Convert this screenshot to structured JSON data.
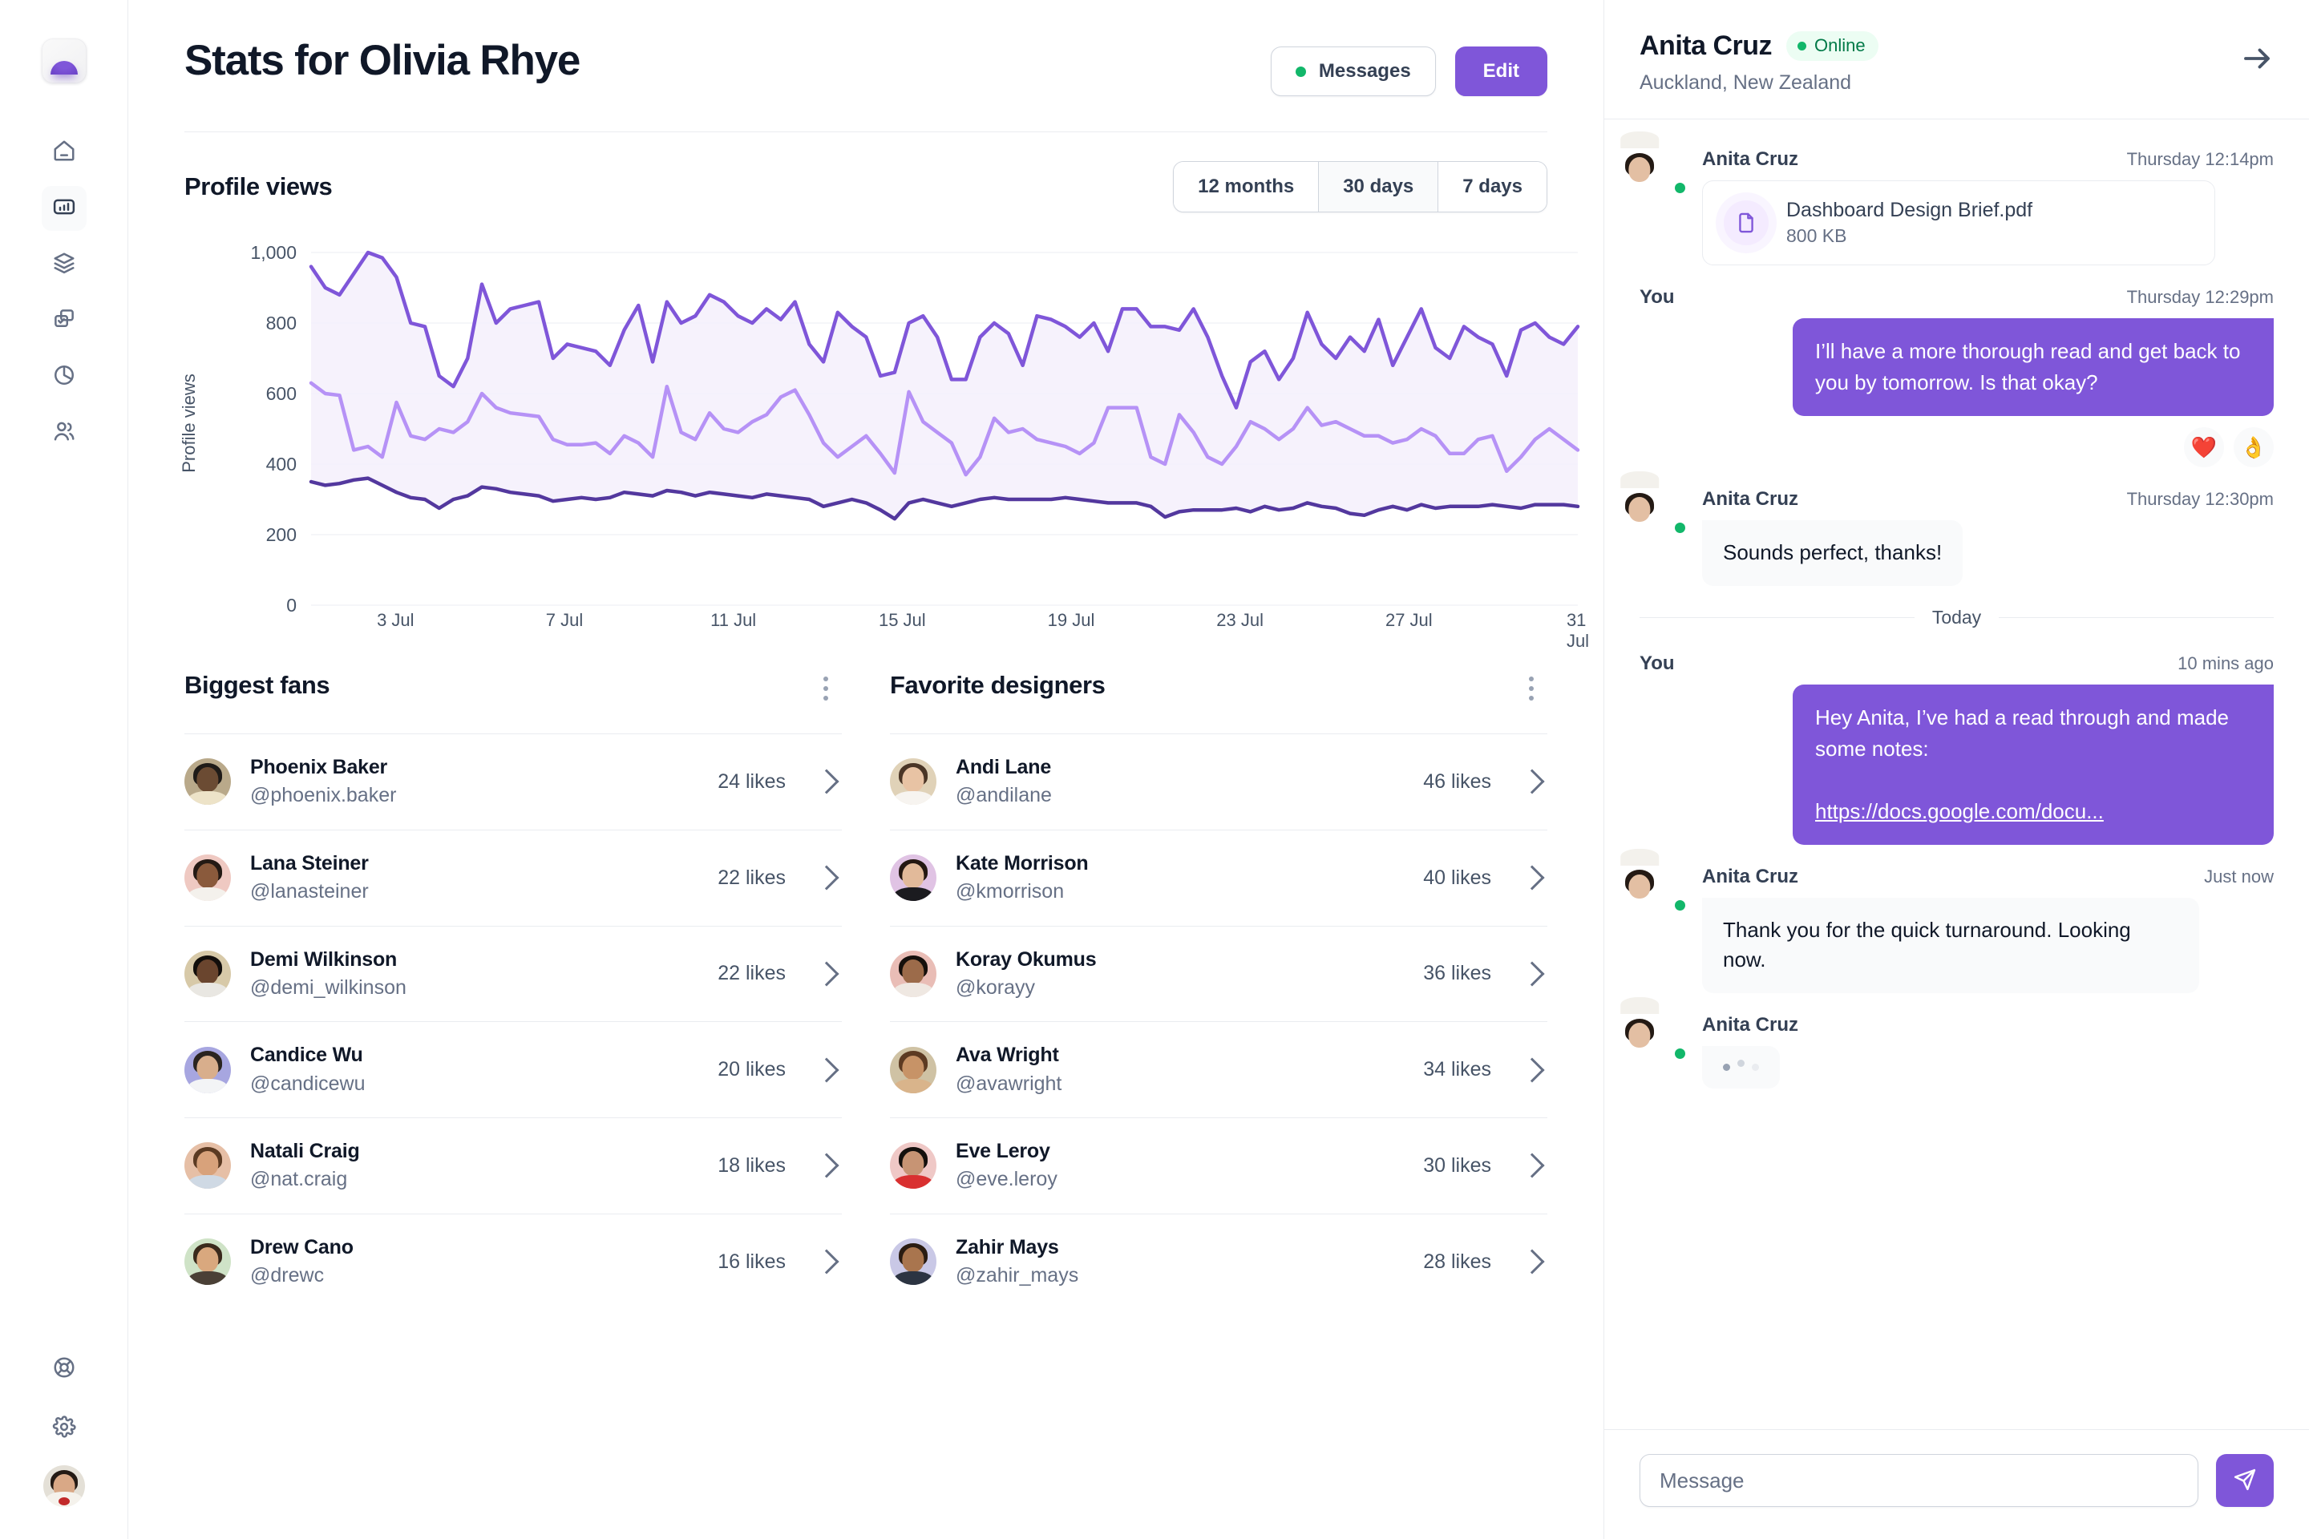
{
  "sidebar": {
    "logo_name": "app-logo",
    "items": [
      {
        "name": "home",
        "icon": "home-icon",
        "active": false
      },
      {
        "name": "stats",
        "icon": "bar-chart-icon",
        "active": true
      },
      {
        "name": "layers",
        "icon": "layers-icon",
        "active": false
      },
      {
        "name": "projects",
        "icon": "checkbox-window-icon",
        "active": false
      },
      {
        "name": "reports",
        "icon": "pie-chart-icon",
        "active": false
      },
      {
        "name": "users",
        "icon": "users-icon",
        "active": false
      }
    ],
    "bottom_items": [
      {
        "name": "support",
        "icon": "lifebuoy-icon"
      },
      {
        "name": "settings",
        "icon": "gear-icon"
      }
    ],
    "profile_avatar": "user-avatar"
  },
  "header": {
    "title": "Stats for Olivia Rhye",
    "messages_label": "Messages",
    "edit_label": "Edit"
  },
  "chart_card": {
    "title": "Profile views",
    "ranges": [
      {
        "label": "12 months",
        "active": false
      },
      {
        "label": "30 days",
        "active": true
      },
      {
        "label": "7 days",
        "active": false
      }
    ]
  },
  "chart_data": {
    "type": "line",
    "title": "Profile views",
    "xlabel": "",
    "ylabel": "Profile views",
    "ylim": [
      0,
      1000
    ],
    "yticks": [
      "0",
      "200",
      "400",
      "600",
      "800",
      "1,000"
    ],
    "xticks": [
      "3 Jul",
      "7 Jul",
      "11 Jul",
      "15 Jul",
      "19 Jul",
      "23 Jul",
      "27 Jul",
      "31 Jul"
    ],
    "grid": true,
    "legend": "none",
    "area_fill": true,
    "colors": {
      "series_a": "#7F56D9",
      "series_b": "#B692F6",
      "series_c": "#53389E"
    },
    "x": [
      1,
      2,
      3,
      4,
      5,
      6,
      7,
      8,
      9,
      10,
      11,
      12,
      13,
      14,
      15,
      16,
      17,
      18,
      19,
      20,
      21,
      22,
      23,
      24,
      25,
      26,
      27,
      28,
      29,
      30,
      31,
      32,
      33,
      34,
      35,
      36,
      37,
      38,
      39,
      40,
      41,
      42,
      43,
      44,
      45,
      46,
      47,
      48,
      49,
      50,
      51,
      52,
      53,
      54,
      55,
      56,
      57,
      58,
      59,
      60,
      61,
      62,
      63,
      64,
      65,
      66,
      67,
      68,
      69,
      70,
      71,
      72,
      73,
      74,
      75,
      76,
      77,
      78,
      79,
      80,
      81,
      82,
      83,
      84,
      85,
      86,
      87,
      88,
      89,
      90
    ],
    "series": [
      {
        "name": "series_a",
        "color": "#7F56D9",
        "values": [
          960,
          900,
          880,
          940,
          1000,
          985,
          930,
          800,
          790,
          650,
          620,
          700,
          910,
          800,
          840,
          850,
          860,
          700,
          740,
          730,
          720,
          680,
          780,
          850,
          690,
          860,
          800,
          820,
          880,
          860,
          820,
          800,
          840,
          810,
          860,
          740,
          690,
          830,
          790,
          760,
          650,
          660,
          800,
          820,
          760,
          640,
          640,
          760,
          800,
          770,
          680,
          820,
          810,
          790,
          760,
          800,
          720,
          840,
          840,
          790,
          790,
          780,
          840,
          760,
          650,
          560,
          690,
          720,
          640,
          700,
          830,
          740,
          700,
          760,
          720,
          810,
          680,
          760,
          840,
          730,
          700,
          790,
          760,
          740,
          650,
          780,
          800,
          760,
          740,
          790
        ]
      },
      {
        "name": "series_b",
        "color": "#B692F6",
        "values": [
          630,
          600,
          595,
          440,
          450,
          420,
          575,
          480,
          470,
          500,
          490,
          520,
          600,
          560,
          545,
          540,
          535,
          470,
          455,
          455,
          460,
          430,
          480,
          460,
          420,
          620,
          490,
          470,
          545,
          500,
          490,
          520,
          540,
          590,
          610,
          540,
          460,
          420,
          450,
          480,
          430,
          375,
          605,
          520,
          490,
          460,
          370,
          420,
          530,
          490,
          500,
          470,
          460,
          450,
          430,
          460,
          560,
          560,
          560,
          420,
          400,
          540,
          490,
          420,
          400,
          450,
          520,
          500,
          470,
          500,
          560,
          510,
          520,
          500,
          480,
          480,
          460,
          470,
          500,
          480,
          430,
          430,
          470,
          480,
          380,
          420,
          470,
          500,
          470,
          440
        ]
      },
      {
        "name": "series_c",
        "color": "#53389E",
        "values": [
          350,
          340,
          345,
          355,
          360,
          340,
          320,
          305,
          300,
          275,
          300,
          310,
          335,
          330,
          320,
          315,
          310,
          295,
          300,
          305,
          300,
          305,
          320,
          315,
          310,
          325,
          320,
          310,
          320,
          315,
          310,
          305,
          315,
          310,
          305,
          300,
          280,
          290,
          300,
          290,
          270,
          245,
          290,
          300,
          290,
          280,
          290,
          300,
          305,
          300,
          300,
          300,
          300,
          305,
          300,
          295,
          290,
          290,
          290,
          280,
          250,
          265,
          270,
          270,
          270,
          275,
          265,
          280,
          270,
          275,
          290,
          280,
          275,
          260,
          255,
          270,
          280,
          270,
          285,
          275,
          280,
          280,
          280,
          285,
          280,
          275,
          285,
          285,
          285,
          280
        ]
      }
    ]
  },
  "fans_card": {
    "title": "Biggest fans",
    "menu_icon": "kebab-menu-icon",
    "rows": [
      {
        "name": "Phoenix Baker",
        "handle": "@phoenix.baker",
        "likes": "24 likes",
        "hair": "#1F1B18",
        "skin": "#6B4B33",
        "body": "#EDE3C8",
        "bg": "#B9A98A"
      },
      {
        "name": "Lana Steiner",
        "handle": "@lanasteiner",
        "likes": "22 likes",
        "hair": "#241A14",
        "skin": "#8A5A3C",
        "body": "#F4F1EC",
        "bg": "#EFC9C2"
      },
      {
        "name": "Demi Wilkinson",
        "handle": "@demi_wilkinson",
        "likes": "22 likes",
        "hair": "#120E0B",
        "skin": "#6A452E",
        "body": "#E9E7E2",
        "bg": "#D7C9A8"
      },
      {
        "name": "Candice Wu",
        "handle": "@candicewu",
        "likes": "20 likes",
        "hair": "#2A2420",
        "skin": "#D8AE8C",
        "body": "#F3F4F6",
        "bg": "#A7A6E0"
      },
      {
        "name": "Natali Craig",
        "handle": "@nat.craig",
        "likes": "18 likes",
        "hair": "#5B3A22",
        "skin": "#D8A27B",
        "body": "#CFD9E4",
        "bg": "#E6BFA6"
      },
      {
        "name": "Drew Cano",
        "handle": "@drewc",
        "likes": "16 likes",
        "hair": "#3A2A1C",
        "skin": "#D9A87E",
        "body": "#4A4036",
        "bg": "#CFE3C7"
      }
    ]
  },
  "designers_card": {
    "title": "Favorite designers",
    "menu_icon": "kebab-menu-icon",
    "rows": [
      {
        "name": "Andi Lane",
        "handle": "@andilane",
        "likes": "46 likes",
        "hair": "#4A3526",
        "skin": "#E8C3A4",
        "body": "#F7F4F0",
        "bg": "#E0D2B8"
      },
      {
        "name": "Kate Morrison",
        "handle": "@kmorrison",
        "likes": "40 likes",
        "hair": "#241812",
        "skin": "#E2BA9A",
        "body": "#1B1B1F",
        "bg": "#E0C3E4"
      },
      {
        "name": "Koray Okumus",
        "handle": "@korayy",
        "likes": "36 likes",
        "hair": "#15100C",
        "skin": "#9C6B4A",
        "body": "#EFE8E2",
        "bg": "#E9BDB6"
      },
      {
        "name": "Ava Wright",
        "handle": "@avawright",
        "likes": "34 likes",
        "hair": "#5C3A22",
        "skin": "#C79367",
        "body": "#D9B48B",
        "bg": "#CFC2A4"
      },
      {
        "name": "Eve Leroy",
        "handle": "@eve.leroy",
        "likes": "30 likes",
        "hair": "#14100D",
        "skin": "#C79474",
        "body": "#D93030",
        "bg": "#EFC8C6"
      },
      {
        "name": "Zahir Mays",
        "handle": "@zahir_mays",
        "likes": "28 likes",
        "hair": "#2A1C12",
        "skin": "#A9754E",
        "body": "#2C3442",
        "bg": "#C9C8E6"
      }
    ]
  },
  "chat": {
    "contact_name": "Anita Cruz",
    "status_label": "Online",
    "location": "Auckland, New Zealand",
    "expand_icon": "arrow-right-icon",
    "day_separator": "Today",
    "input_placeholder": "Message",
    "send_icon": "send-icon",
    "messages": [
      {
        "type": "file",
        "side": "in",
        "sender": "Anita Cruz",
        "time": "Thursday 12:14pm",
        "file_name": "Dashboard Design Brief.pdf",
        "file_size": "800 KB",
        "file_icon": "file-icon"
      },
      {
        "type": "text",
        "side": "out",
        "sender": "You",
        "time": "Thursday 12:29pm",
        "text": "I’ll have a more thorough read and get back to you by tomorrow. Is that okay?",
        "reactions": [
          "❤️",
          "👌"
        ]
      },
      {
        "type": "text",
        "side": "in",
        "sender": "Anita Cruz",
        "time": "Thursday 12:30pm",
        "text": "Sounds perfect, thanks!"
      },
      {
        "type": "link",
        "side": "out",
        "sender": "You",
        "time": "10 mins ago",
        "text": "Hey Anita, I’ve had a read through and made some notes:",
        "link_text": "https://docs.google.com/docu..."
      },
      {
        "type": "text",
        "side": "in",
        "sender": "Anita Cruz",
        "time": "Just now",
        "text": "Thank you for the quick turnaround. Looking now."
      },
      {
        "type": "typing",
        "side": "in",
        "sender": "Anita Cruz",
        "time": ""
      }
    ]
  },
  "colors": {
    "brand": "#7F56D9",
    "brand_dark": "#53389E",
    "brand_light": "#B692F6",
    "success": "#12B76A",
    "border": "#EAECF0",
    "text": "#101828",
    "text_muted": "#667085"
  }
}
